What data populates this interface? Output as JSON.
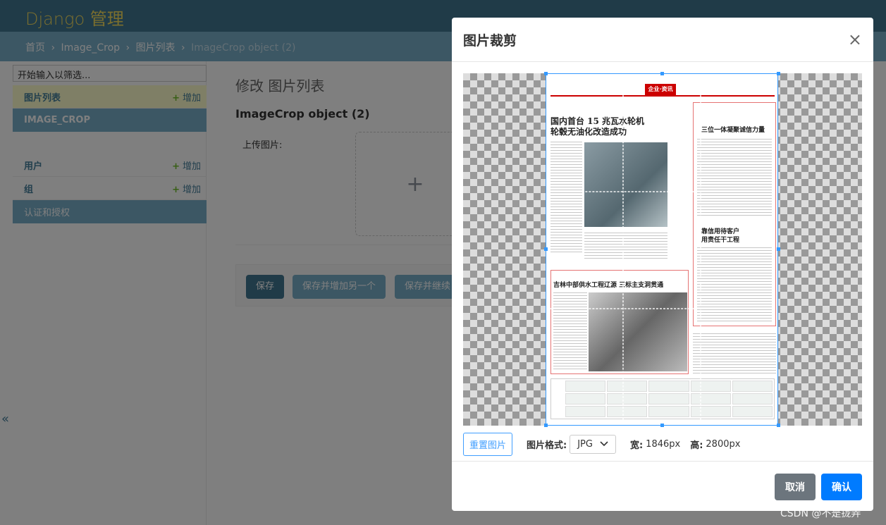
{
  "header": {
    "brand": "Django 管理"
  },
  "breadcrumbs": {
    "home": "首页",
    "app": "Image_Crop",
    "model": "图片列表",
    "current": "ImageCrop object (2)",
    "sep": "›"
  },
  "sidebar": {
    "filter_placeholder": "开始输入以筛选...",
    "image_crop_module": {
      "item": "图片列表",
      "add": "增加",
      "caption": "IMAGE_CROP"
    },
    "auth_module": {
      "users": "用户",
      "users_add": "增加",
      "groups": "组",
      "groups_add": "增加",
      "caption": "认证和授权"
    },
    "collapse": "«"
  },
  "content": {
    "title": "修改 图片列表",
    "object": "ImageCrop object (2)",
    "upload_label": "上传图片:",
    "upload_plus": "+",
    "buttons": {
      "save": "保存",
      "save_add": "保存并增加另一个",
      "save_continue": "保存并继续"
    }
  },
  "modal": {
    "title": "图片裁剪",
    "close": "×",
    "reset": "重置图片",
    "format_label": "图片格式:",
    "format_value": "JPG",
    "width_label": "宽:",
    "width_value": "1846px",
    "height_label": "高:",
    "height_value": "2800px",
    "cancel": "取消",
    "confirm": "确认"
  },
  "newspaper": {
    "section": "企业·资讯",
    "headline1": "国内首台 15 兆瓦水轮机\n轮毂无油化改造成功",
    "headline2": "吉林中部供水工程辽源 三标主支洞贯通",
    "headline3": "三位一体凝聚诚信力量",
    "headline4": "靠信用待客户\n用责任干工程"
  },
  "watermark": "CSDN @不是拢弄"
}
